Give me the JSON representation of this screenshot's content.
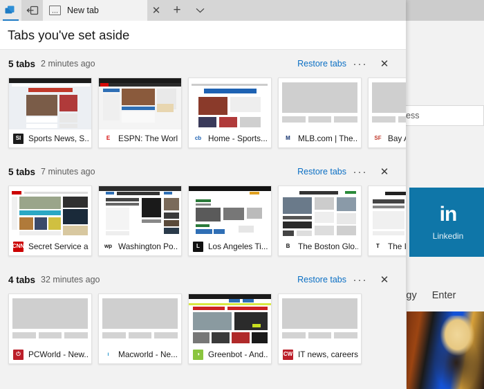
{
  "window": {
    "setaside_icon": "set-tabs-aside-icon",
    "restore_icon": "tabs-you-set-aside-icon",
    "plus_label": "+",
    "chevron_label": "∨",
    "close_label": "✕"
  },
  "browser_tab": {
    "title": "New tab",
    "favicon": "newtab-icon"
  },
  "panel": {
    "heading": "Tabs you've set aside"
  },
  "group_actions": {
    "restore_label": "Restore tabs",
    "more_label": "···",
    "close_label": "✕"
  },
  "groups": [
    {
      "count_label": "5 tabs",
      "time_label": "2 minutes ago",
      "cards": [
        {
          "title": "Sports News, S...",
          "favicon": "si-icon",
          "fav_text": "SI",
          "fav_bg": "#1c1c1c",
          "fav_fg": "#ffffff",
          "thumb": "si"
        },
        {
          "title": "ESPN: The Worl...",
          "favicon": "espn-icon",
          "fav_text": "E",
          "fav_bg": "#ffffff",
          "fav_fg": "#d60a0a",
          "thumb": "espn"
        },
        {
          "title": "Home - Sports...",
          "favicon": "cbssports-icon",
          "fav_text": "cb",
          "fav_bg": "#ffffff",
          "fav_fg": "#1d62b3",
          "thumb": "cbs"
        },
        {
          "title": "MLB.com | The...",
          "favicon": "mlb-icon",
          "fav_text": "M",
          "fav_bg": "#ffffff",
          "fav_fg": "#14326e",
          "thumb": "skeleton"
        },
        {
          "title": "Bay A",
          "favicon": "sfgate-icon",
          "fav_text": "SF",
          "fav_bg": "#ffffff",
          "fav_fg": "#c0392b",
          "thumb": "skeleton"
        }
      ]
    },
    {
      "count_label": "5 tabs",
      "time_label": "7 minutes ago",
      "cards": [
        {
          "title": "Secret Service a...",
          "favicon": "cnn-icon",
          "fav_text": "CNN",
          "fav_bg": "#cc0000",
          "fav_fg": "#ffffff",
          "thumb": "cnn"
        },
        {
          "title": "Washington Po...",
          "favicon": "washpost-icon",
          "fav_text": "wp",
          "fav_bg": "#ffffff",
          "fav_fg": "#111111",
          "thumb": "wapo"
        },
        {
          "title": "Los Angeles Ti...",
          "favicon": "latimes-icon",
          "fav_text": "L",
          "fav_bg": "#111111",
          "fav_fg": "#ffffff",
          "thumb": "lat"
        },
        {
          "title": "The Boston Glo...",
          "favicon": "bostonglobe-icon",
          "fav_text": "B",
          "fav_bg": "#ffffff",
          "fav_fg": "#111111",
          "thumb": "globe"
        },
        {
          "title": "The I",
          "favicon": "nytimes-icon",
          "fav_text": "T",
          "fav_bg": "#ffffff",
          "fav_fg": "#111111",
          "thumb": "nyt"
        }
      ]
    },
    {
      "count_label": "4 tabs",
      "time_label": "32 minutes ago",
      "cards": [
        {
          "title": "PCWorld - New...",
          "favicon": "pcworld-icon",
          "fav_text": "⏻",
          "fav_bg": "#bb1f2a",
          "fav_fg": "#ffffff",
          "thumb": "skeleton"
        },
        {
          "title": "Macworld - Ne...",
          "favicon": "macworld-icon",
          "fav_text": "ı",
          "fav_bg": "#ffffff",
          "fav_fg": "#2e9ad0",
          "thumb": "skeleton"
        },
        {
          "title": "Greenbot - And...",
          "favicon": "greenbot-icon",
          "fav_text": "◑",
          "fav_bg": "#8bc53f",
          "fav_fg": "#ffffff",
          "thumb": "greenbot"
        },
        {
          "title": "IT news, careers...",
          "favicon": "computerworld-icon",
          "fav_text": "CW",
          "fav_bg": "#bb1f2a",
          "fav_fg": "#ffffff",
          "thumb": "skeleton"
        }
      ]
    }
  ],
  "background_page": {
    "address_text": "ess",
    "tile": {
      "glyph": "in",
      "label": "Linkedin",
      "color": "#0f76a8"
    },
    "nav_items": [
      "nology",
      "Enter"
    ]
  }
}
